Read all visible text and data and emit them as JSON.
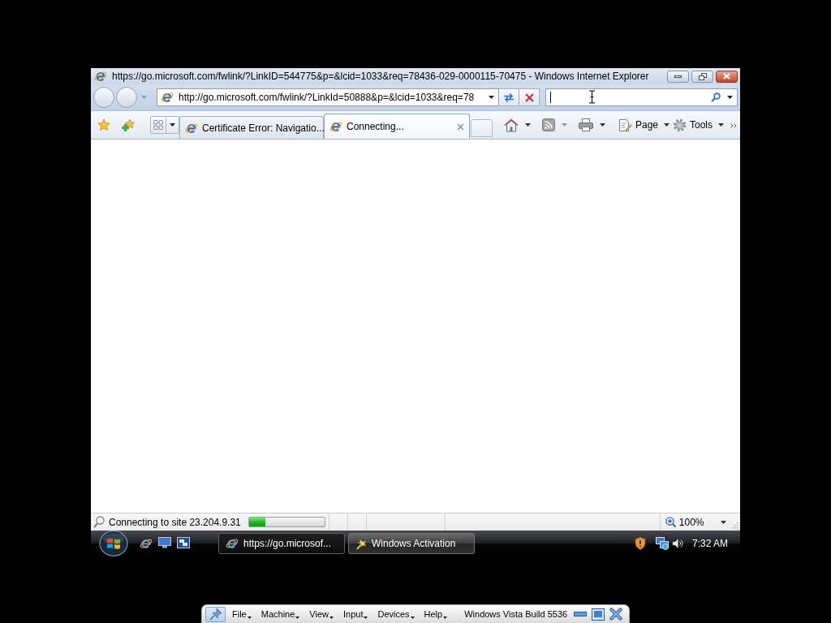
{
  "window": {
    "title": "https://go.microsoft.com/fwlink/?LinkID=544775&p=&lcid=1033&req=78436-029-0000115-70475 - Windows Internet Explorer"
  },
  "address_bar": {
    "url": "http://go.microsoft.com/fwlink/?LinkId=50888&p=&lcid=1033&req=78"
  },
  "search": {
    "focused": true
  },
  "tabs": [
    {
      "label": "Certificate Error: Navigatio...",
      "selected": false
    },
    {
      "label": "Connecting...",
      "selected": true
    }
  ],
  "command_bar": {
    "page": "Page",
    "tools": "Tools"
  },
  "status_bar": {
    "text": "Connecting to site 23.204.9.31",
    "progress": {
      "level": 0.22
    },
    "zoom": "100%"
  },
  "taskbar": {
    "buttons": [
      {
        "label": "https://go.microsof...",
        "kind": "browser",
        "selected": true
      },
      {
        "label": "Windows Activation",
        "kind": "activation",
        "selected": false
      }
    ],
    "clock": "7:32 AM"
  },
  "vm_toolbar": {
    "menus": [
      "File",
      "Machine",
      "View",
      "Input",
      "Devices",
      "Help"
    ],
    "title": "Windows Vista Build 5536"
  }
}
